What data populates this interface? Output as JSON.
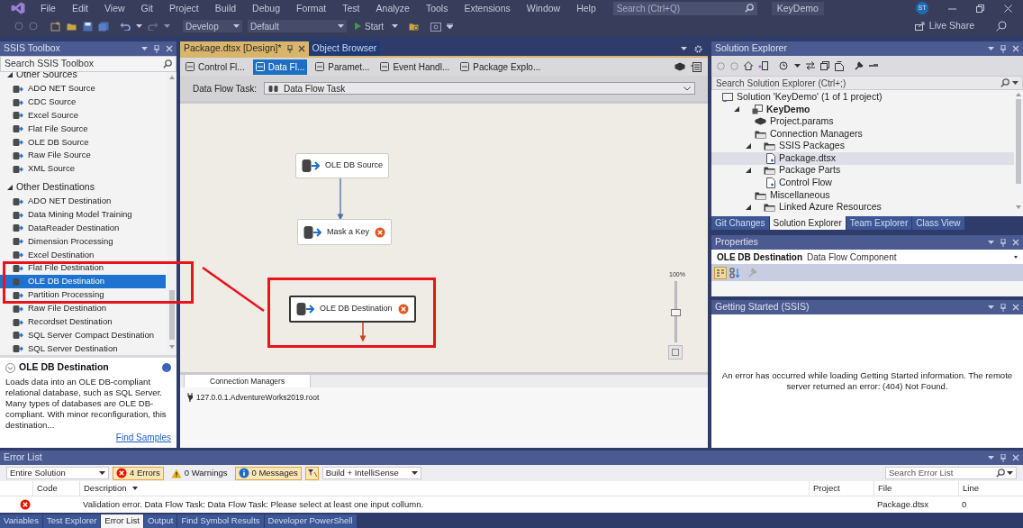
{
  "menu": [
    "File",
    "Edit",
    "View",
    "Git",
    "Project",
    "Build",
    "Debug",
    "Format",
    "Test",
    "Analyze",
    "Tools",
    "Extensions",
    "Window",
    "Help"
  ],
  "search": {
    "placeholder": "Search (Ctrl+Q)"
  },
  "solution_name": "KeyDemo",
  "user_initials": "ST",
  "toolbar": {
    "configuration": "Develop",
    "platform": "Default",
    "start": "Start",
    "live_share": "Live Share"
  },
  "toolbox": {
    "title": "SSIS Toolbox",
    "search": {
      "placeholder": "Search SSIS Toolbox"
    },
    "groups": [
      {
        "label": "Other Sources",
        "expanded": true,
        "items": [
          {
            "label": "ADO NET Source",
            "selected": false
          },
          {
            "label": "CDC Source",
            "selected": false
          },
          {
            "label": "Excel Source",
            "selected": false
          },
          {
            "label": "Flat File Source",
            "selected": false
          },
          {
            "label": "OLE DB Source",
            "selected": false
          },
          {
            "label": "Raw File Source",
            "selected": false
          },
          {
            "label": "XML Source",
            "selected": false
          }
        ]
      },
      {
        "label": "Other Destinations",
        "expanded": true,
        "items": [
          {
            "label": "ADO NET Destination",
            "selected": false
          },
          {
            "label": "Data Mining Model Training",
            "selected": false
          },
          {
            "label": "DataReader Destination",
            "selected": false
          },
          {
            "label": "Dimension Processing",
            "selected": false
          },
          {
            "label": "Excel Destination",
            "selected": false
          },
          {
            "label": "Flat File Destination",
            "selected": false
          },
          {
            "label": "OLE DB Destination",
            "selected": true
          },
          {
            "label": "Partition Processing",
            "selected": false
          },
          {
            "label": "Raw File Destination",
            "selected": false
          },
          {
            "label": "Recordset Destination",
            "selected": false
          },
          {
            "label": "SQL Server Compact Destination",
            "selected": false
          },
          {
            "label": "SQL Server Destination",
            "selected": false
          }
        ]
      }
    ],
    "description": {
      "title": "OLE DB Destination",
      "text": "Loads data into an OLE DB-compliant relational database, such as SQL Server. Many types of databases are OLE DB-compliant. With minor reconfiguration, this destination...",
      "link": "Find Samples"
    }
  },
  "document_tabs": [
    {
      "label": "Package.dtsx [Design]*",
      "selected": true
    },
    {
      "label": "Object Browser",
      "selected": false
    }
  ],
  "designer_tabs": [
    {
      "label": "Control Fl...",
      "selected": false
    },
    {
      "label": "Data Fl...",
      "selected": true
    },
    {
      "label": "Paramet...",
      "selected": false
    },
    {
      "label": "Event Handl...",
      "selected": false
    },
    {
      "label": "Package Explo...",
      "selected": false
    }
  ],
  "task_selector": {
    "label": "Data Flow Task:",
    "value": "Data Flow Task"
  },
  "canvas": {
    "nodes": [
      {
        "label": "OLE DB Source",
        "error": false,
        "selected": false
      },
      {
        "label": "Mask a Key",
        "error": true,
        "selected": false
      },
      {
        "label": "OLE DB Destination",
        "error": true,
        "selected": true
      }
    ],
    "zoom": {
      "label": "100%",
      "level": 0.5
    }
  },
  "connection_managers": {
    "tab": "Connection Managers",
    "items": [
      "127.0.0.1.AdventureWorks2019.root"
    ]
  },
  "solution_explorer": {
    "title": "Solution Explorer",
    "search": {
      "placeholder": "Search Solution Explorer (Ctrl+;)"
    },
    "tree": [
      {
        "label": "Solution 'KeyDemo' (1 of 1 project)",
        "selected": false,
        "children": [
          {
            "label": "KeyDemo",
            "bold": true,
            "expanded": true,
            "selected": false,
            "children": [
              {
                "label": "Project.params",
                "selected": false
              },
              {
                "label": "Connection Managers",
                "selected": false
              },
              {
                "label": "SSIS Packages",
                "expanded": true,
                "selected": false,
                "children": [
                  {
                    "label": "Package.dtsx",
                    "selected": true
                  }
                ]
              },
              {
                "label": "Package Parts",
                "expanded": true,
                "selected": false,
                "children": [
                  {
                    "label": "Control Flow",
                    "selected": false
                  }
                ]
              },
              {
                "label": "Miscellaneous",
                "selected": false
              },
              {
                "label": "Linked Azure Resources",
                "expanded": true,
                "selected": false
              }
            ]
          }
        ]
      }
    ],
    "tabs": [
      {
        "label": "Git Changes",
        "selected": false
      },
      {
        "label": "Solution Explorer",
        "selected": true
      },
      {
        "label": "Team Explorer",
        "selected": false
      },
      {
        "label": "Class View",
        "selected": false
      }
    ]
  },
  "properties": {
    "title": "Properties",
    "object": "OLE DB Destination",
    "type": "Data Flow Component"
  },
  "getting_started": {
    "title": "Getting Started (SSIS)",
    "message": "An error has occurred while loading Getting Started information. The remote server returned an error: (404) Not Found."
  },
  "error_list": {
    "title": "Error List",
    "scope": "Entire Solution",
    "filters": [
      {
        "kind": "error",
        "label": "4 Errors",
        "on": true
      },
      {
        "kind": "warning",
        "label": "0 Warnings",
        "on": false
      },
      {
        "kind": "message",
        "label": "0 Messages",
        "on": true
      }
    ],
    "build": "Build + IntelliSense",
    "search": {
      "placeholder": "Search Error List"
    },
    "columns": [
      "Code",
      "Description",
      "Project",
      "File",
      "Line"
    ],
    "rows": [
      {
        "kind": "error",
        "code": "",
        "description": "Validation error. Data Flow Task: Data Flow Task: Please select at least one input collumn.",
        "project": "",
        "file": "Package.dtsx",
        "line": "0"
      }
    ]
  },
  "bottom_tabs": [
    {
      "label": "Variables",
      "selected": false
    },
    {
      "label": "Test Explorer",
      "selected": false
    },
    {
      "label": "Error List",
      "selected": true
    },
    {
      "label": "Output",
      "selected": false
    },
    {
      "label": "Find Symbol Results",
      "selected": false
    },
    {
      "label": "Developer PowerShell",
      "selected": false
    }
  ]
}
